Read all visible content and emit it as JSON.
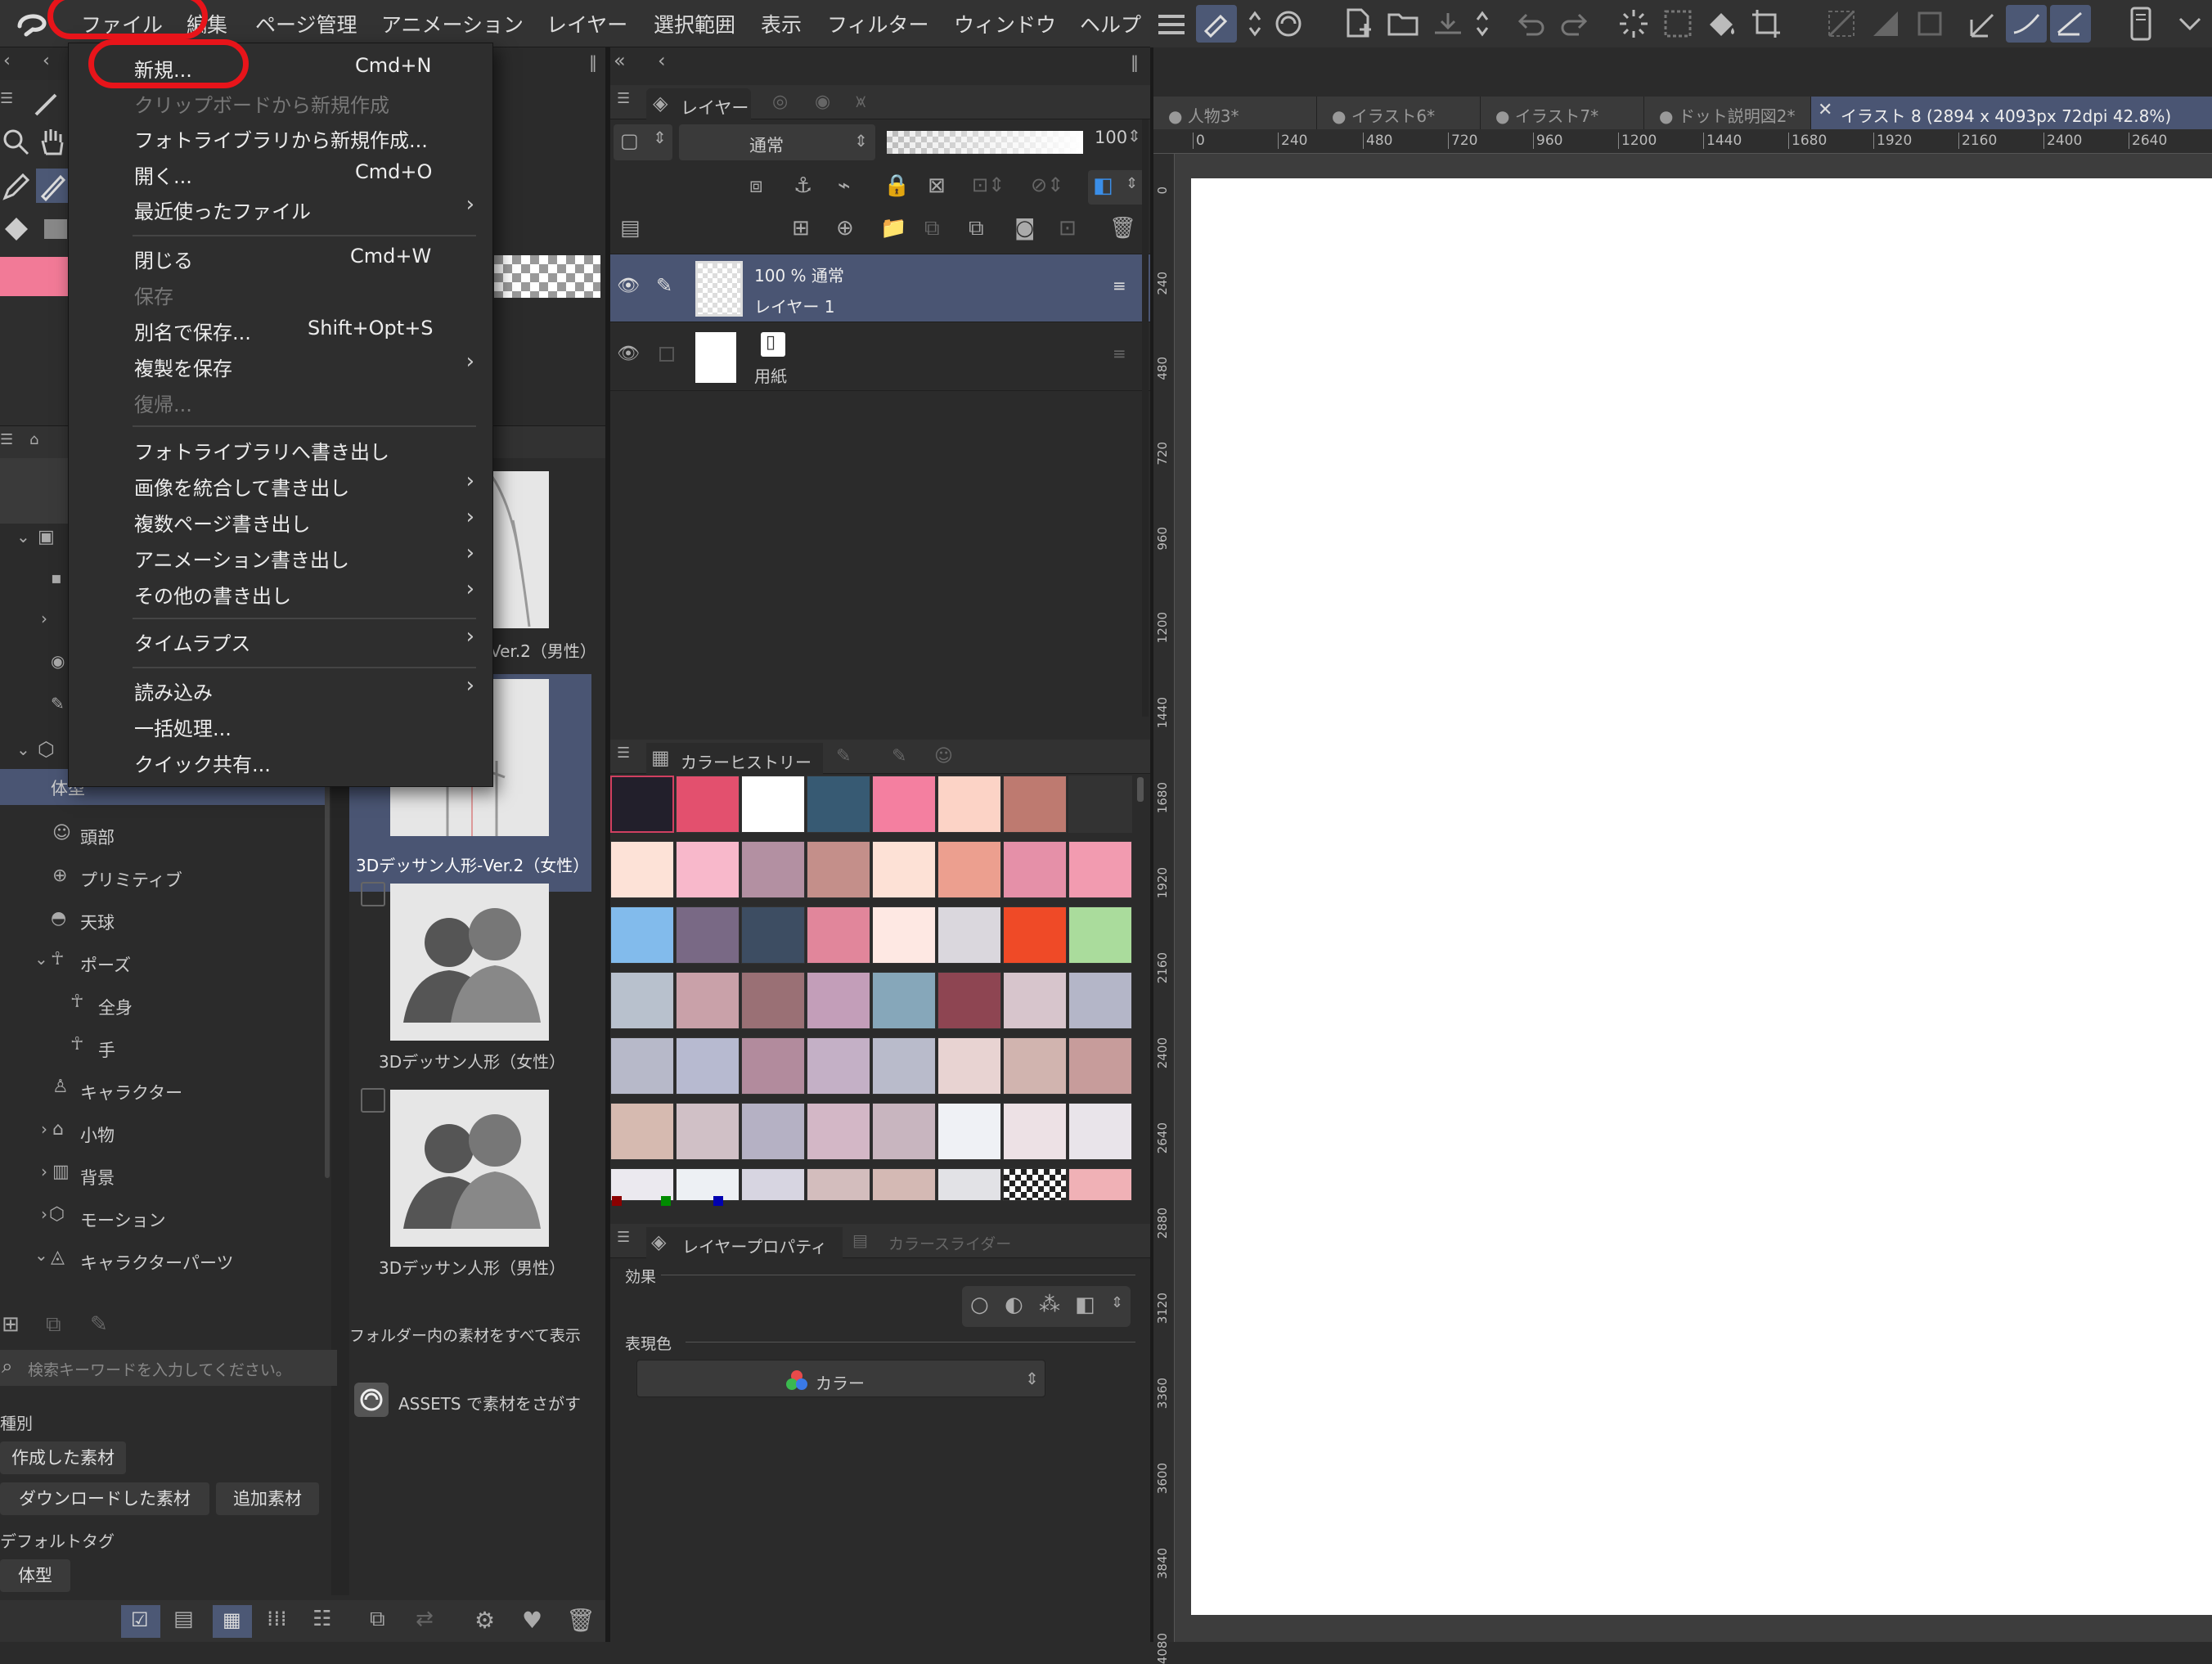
{
  "menubar": {
    "items": [
      "ファイル",
      "編集",
      "ページ管理",
      "アニメーション",
      "レイヤー",
      "選択範囲",
      "表示",
      "フィルター",
      "ウィンドウ",
      "ヘルプ"
    ]
  },
  "file_menu": {
    "items": [
      {
        "label": "新規...",
        "shortcut": "Cmd+N",
        "enabled": true,
        "submenu": false
      },
      {
        "label": "クリップボードから新規作成",
        "shortcut": "",
        "enabled": false,
        "submenu": false
      },
      {
        "label": "フォトライブラリから新規作成...",
        "shortcut": "",
        "enabled": true,
        "submenu": false
      },
      {
        "label": "開く...",
        "shortcut": "Cmd+O",
        "enabled": true,
        "submenu": false
      },
      {
        "label": "最近使ったファイル",
        "shortcut": "",
        "enabled": true,
        "submenu": true
      },
      {
        "label": "閉じる",
        "shortcut": "Cmd+W",
        "enabled": true,
        "submenu": false
      },
      {
        "label": "保存",
        "shortcut": "",
        "enabled": false,
        "submenu": false
      },
      {
        "label": "別名で保存...",
        "shortcut": "Shift+Opt+S",
        "enabled": true,
        "submenu": false
      },
      {
        "label": "複製を保存",
        "shortcut": "",
        "enabled": true,
        "submenu": true
      },
      {
        "label": "復帰...",
        "shortcut": "",
        "enabled": false,
        "submenu": false
      },
      {
        "label": "フォトライブラリへ書き出し",
        "shortcut": "",
        "enabled": true,
        "submenu": false
      },
      {
        "label": "画像を統合して書き出し",
        "shortcut": "",
        "enabled": true,
        "submenu": true
      },
      {
        "label": "複数ページ書き出し",
        "shortcut": "",
        "enabled": true,
        "submenu": true
      },
      {
        "label": "アニメーション書き出し",
        "shortcut": "",
        "enabled": true,
        "submenu": true
      },
      {
        "label": "その他の書き出し",
        "shortcut": "",
        "enabled": true,
        "submenu": true
      },
      {
        "label": "タイムラプス",
        "shortcut": "",
        "enabled": true,
        "submenu": true
      },
      {
        "label": "読み込み",
        "shortcut": "",
        "enabled": true,
        "submenu": true
      },
      {
        "label": "一括処理...",
        "shortcut": "",
        "enabled": true,
        "submenu": false
      },
      {
        "label": "クイック共有...",
        "shortcut": "",
        "enabled": true,
        "submenu": false
      }
    ]
  },
  "layer_panel": {
    "tab_label": "レイヤー",
    "blend_mode": "通常",
    "opacity": "100",
    "layers": [
      {
        "opacity_mode": "100 % 通常",
        "name": "レイヤー 1",
        "selected": true
      },
      {
        "opacity_mode": "",
        "name": "用紙",
        "selected": false
      }
    ]
  },
  "color_history": {
    "tab_label": "カラーヒストリー",
    "swatches": [
      "#221f2b",
      "#e3506e",
      "#ffffff",
      "#375a73",
      "#f47fa0",
      "#fcd3c6",
      "#be7a70",
      "#333333",
      "#fde2d7",
      "#f8b8cb",
      "#b390a2",
      "#c48f8a",
      "#fde1d6",
      "#ec9f8f",
      "#e590a8",
      "#f29bb0",
      "#82bbec",
      "#796985",
      "#3d4d62",
      "#e1869b",
      "#fee8e3",
      "#dad7dd",
      "#ef4a27",
      "#aadc9c",
      "#b8c1cd",
      "#c9a1a9",
      "#9a7075",
      "#c39eb9",
      "#86a7ba",
      "#8e4552",
      "#d7c5cc",
      "#b4b6c8",
      "#b7b9c9",
      "#b7bad0",
      "#b28b9d",
      "#c4b0c6",
      "#b9bbcb",
      "#e8d3d2",
      "#d1b4af",
      "#c79c9b",
      "#d6bab0",
      "#d0c0c6",
      "#b5b1c4",
      "#d3b7c6",
      "#c8b5bf",
      "#eff1f5",
      "#ede1e5",
      "#e9e4ea",
      "#ebe9ef",
      "#edf0f4",
      "#d7d5e1",
      "#d3bdbd",
      "#d4b9b4",
      "#e2e2e6",
      "checker",
      "#f0b1b6"
    ]
  },
  "layer_property": {
    "tab_label": "レイヤープロパティ",
    "tab2_label": "カラースライダー",
    "effect_label": "効果",
    "color_label": "表現色",
    "color_value": "カラー"
  },
  "material_panel": {
    "tree": [
      "体型",
      "頭部",
      "プリミティブ",
      "天球",
      "ポーズ",
      "全身",
      "手",
      "キャラクター",
      "小物",
      "背景",
      "モーション",
      "キャラクターパーツ"
    ],
    "thumbs": [
      {
        "caption": "Ver.2（男性）"
      },
      {
        "caption": "3Dデッサン人形-Ver.2（女性）"
      },
      {
        "caption": "3Dデッサン人形（女性）"
      },
      {
        "caption": "3Dデッサン人形（男性）"
      }
    ],
    "show_all": "フォルダー内の素材をすべて表示",
    "assets_search": "ASSETS で素材をさがす",
    "search_placeholder": "検索キーワードを入力してください。",
    "type_label": "種別",
    "type_buttons": [
      "作成した素材",
      "ダウンロードした素材",
      "追加素材"
    ],
    "default_tag_label": "デフォルトタグ",
    "tag_button": "体型"
  },
  "canvas_tabs": [
    "人物3*",
    "イラスト6*",
    "イラスト7*",
    "ドット説明図2*",
    "イラスト 8 (2894 x 4093px 72dpi 42.8%)"
  ],
  "ruler_h": [
    "0",
    "240",
    "480",
    "720",
    "960",
    "1200",
    "1440",
    "1680",
    "1920",
    "2160",
    "2400",
    "2640"
  ],
  "ruler_v": [
    "0",
    "240",
    "480",
    "720",
    "960",
    "1200",
    "1440",
    "1680",
    "1920",
    "2160",
    "2400",
    "2640",
    "2880",
    "3120",
    "3360",
    "3600",
    "3840",
    "4080"
  ],
  "colors": {
    "accent_red": "#e8141a",
    "selected_layer": "#4a5573",
    "canvas": "#ffffff",
    "main_color": "#f27a97"
  }
}
